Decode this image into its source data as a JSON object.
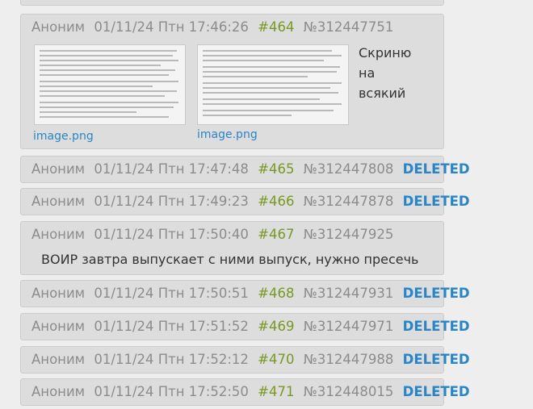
{
  "posts": [
    {
      "author": "Аноним",
      "date": "01/11/24 Птн 17:46:26",
      "num": "#464",
      "id": "№312447751",
      "images": [
        {
          "label": "image.png"
        },
        {
          "label": "image.png"
        }
      ],
      "text_lines": [
        "Скриню",
        "на",
        "всякий"
      ]
    },
    {
      "author": "Аноним",
      "date": "01/11/24 Птн 17:47:48",
      "num": "#465",
      "id": "№312447808",
      "status": "DELETED"
    },
    {
      "author": "Аноним",
      "date": "01/11/24 Птн 17:49:23",
      "num": "#466",
      "id": "№312447878",
      "status": "DELETED"
    },
    {
      "author": "Аноним",
      "date": "01/11/24 Птн 17:50:40",
      "num": "#467",
      "id": "№312447925",
      "text": "ВОИР завтра выпускает с ними выпуск, нужно пресечь"
    },
    {
      "author": "Аноним",
      "date": "01/11/24 Птн 17:50:51",
      "num": "#468",
      "id": "№312447931",
      "status": "DELETED"
    },
    {
      "author": "Аноним",
      "date": "01/11/24 Птн 17:51:52",
      "num": "#469",
      "id": "№312447971",
      "status": "DELETED"
    },
    {
      "author": "Аноним",
      "date": "01/11/24 Птн 17:52:12",
      "num": "#470",
      "id": "№312447988",
      "status": "DELETED"
    },
    {
      "author": "Аноним",
      "date": "01/11/24 Птн 17:52:50",
      "num": "#471",
      "id": "№312448015",
      "status": "DELETED"
    }
  ],
  "colors": {
    "post_bg": "#dddddd",
    "meta_text": "#8c8c8c",
    "post_number": "#789922",
    "deleted_label": "#2a85c8",
    "link": "#2a85c8"
  }
}
